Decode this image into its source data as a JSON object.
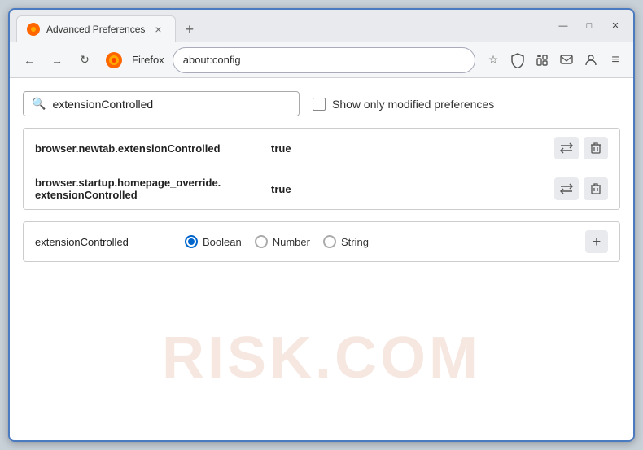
{
  "window": {
    "title": "Advanced Preferences",
    "tab_close": "×",
    "tab_new": "+",
    "btn_minimize": "—",
    "btn_maximize": "□",
    "btn_close": "✕"
  },
  "navbar": {
    "back": "←",
    "forward": "→",
    "refresh": "↻",
    "firefox_label": "Firefox",
    "address": "about:config",
    "bookmark_icon": "☆",
    "shield_icon": "⛨",
    "ext_icon": "🧩",
    "msg_icon": "✉",
    "profile_icon": "⊙",
    "menu_icon": "≡"
  },
  "search": {
    "placeholder": "extensionControlled",
    "value": "extensionControlled",
    "show_modified_label": "Show only modified preferences"
  },
  "results": [
    {
      "name": "browser.newtab.extensionControlled",
      "value": "true"
    },
    {
      "name": "browser.startup.homepage_override.\nextensionControlled",
      "name_line1": "browser.startup.homepage_override.",
      "name_line2": "extensionControlled",
      "value": "true",
      "multiline": true
    }
  ],
  "add_row": {
    "name": "extensionControlled",
    "type_boolean": "Boolean",
    "type_number": "Number",
    "type_string": "String",
    "selected_type": "Boolean"
  },
  "watermark": "RISK.COM",
  "icons": {
    "search": "🔍",
    "swap": "⇄",
    "delete": "🗑",
    "plus": "+"
  }
}
